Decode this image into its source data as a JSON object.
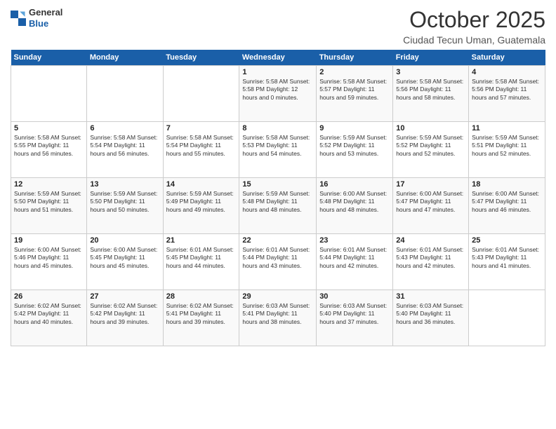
{
  "logo": {
    "general": "General",
    "blue": "Blue"
  },
  "header": {
    "title": "October 2025",
    "location": "Ciudad Tecun Uman, Guatemala"
  },
  "days": [
    "Sunday",
    "Monday",
    "Tuesday",
    "Wednesday",
    "Thursday",
    "Friday",
    "Saturday"
  ],
  "weeks": [
    [
      {
        "num": "",
        "detail": ""
      },
      {
        "num": "",
        "detail": ""
      },
      {
        "num": "",
        "detail": ""
      },
      {
        "num": "1",
        "detail": "Sunrise: 5:58 AM\nSunset: 5:58 PM\nDaylight: 12 hours\nand 0 minutes."
      },
      {
        "num": "2",
        "detail": "Sunrise: 5:58 AM\nSunset: 5:57 PM\nDaylight: 11 hours\nand 59 minutes."
      },
      {
        "num": "3",
        "detail": "Sunrise: 5:58 AM\nSunset: 5:56 PM\nDaylight: 11 hours\nand 58 minutes."
      },
      {
        "num": "4",
        "detail": "Sunrise: 5:58 AM\nSunset: 5:56 PM\nDaylight: 11 hours\nand 57 minutes."
      }
    ],
    [
      {
        "num": "5",
        "detail": "Sunrise: 5:58 AM\nSunset: 5:55 PM\nDaylight: 11 hours\nand 56 minutes."
      },
      {
        "num": "6",
        "detail": "Sunrise: 5:58 AM\nSunset: 5:54 PM\nDaylight: 11 hours\nand 56 minutes."
      },
      {
        "num": "7",
        "detail": "Sunrise: 5:58 AM\nSunset: 5:54 PM\nDaylight: 11 hours\nand 55 minutes."
      },
      {
        "num": "8",
        "detail": "Sunrise: 5:58 AM\nSunset: 5:53 PM\nDaylight: 11 hours\nand 54 minutes."
      },
      {
        "num": "9",
        "detail": "Sunrise: 5:59 AM\nSunset: 5:52 PM\nDaylight: 11 hours\nand 53 minutes."
      },
      {
        "num": "10",
        "detail": "Sunrise: 5:59 AM\nSunset: 5:52 PM\nDaylight: 11 hours\nand 52 minutes."
      },
      {
        "num": "11",
        "detail": "Sunrise: 5:59 AM\nSunset: 5:51 PM\nDaylight: 11 hours\nand 52 minutes."
      }
    ],
    [
      {
        "num": "12",
        "detail": "Sunrise: 5:59 AM\nSunset: 5:50 PM\nDaylight: 11 hours\nand 51 minutes."
      },
      {
        "num": "13",
        "detail": "Sunrise: 5:59 AM\nSunset: 5:50 PM\nDaylight: 11 hours\nand 50 minutes."
      },
      {
        "num": "14",
        "detail": "Sunrise: 5:59 AM\nSunset: 5:49 PM\nDaylight: 11 hours\nand 49 minutes."
      },
      {
        "num": "15",
        "detail": "Sunrise: 5:59 AM\nSunset: 5:48 PM\nDaylight: 11 hours\nand 48 minutes."
      },
      {
        "num": "16",
        "detail": "Sunrise: 6:00 AM\nSunset: 5:48 PM\nDaylight: 11 hours\nand 48 minutes."
      },
      {
        "num": "17",
        "detail": "Sunrise: 6:00 AM\nSunset: 5:47 PM\nDaylight: 11 hours\nand 47 minutes."
      },
      {
        "num": "18",
        "detail": "Sunrise: 6:00 AM\nSunset: 5:47 PM\nDaylight: 11 hours\nand 46 minutes."
      }
    ],
    [
      {
        "num": "19",
        "detail": "Sunrise: 6:00 AM\nSunset: 5:46 PM\nDaylight: 11 hours\nand 45 minutes."
      },
      {
        "num": "20",
        "detail": "Sunrise: 6:00 AM\nSunset: 5:45 PM\nDaylight: 11 hours\nand 45 minutes."
      },
      {
        "num": "21",
        "detail": "Sunrise: 6:01 AM\nSunset: 5:45 PM\nDaylight: 11 hours\nand 44 minutes."
      },
      {
        "num": "22",
        "detail": "Sunrise: 6:01 AM\nSunset: 5:44 PM\nDaylight: 11 hours\nand 43 minutes."
      },
      {
        "num": "23",
        "detail": "Sunrise: 6:01 AM\nSunset: 5:44 PM\nDaylight: 11 hours\nand 42 minutes."
      },
      {
        "num": "24",
        "detail": "Sunrise: 6:01 AM\nSunset: 5:43 PM\nDaylight: 11 hours\nand 42 minutes."
      },
      {
        "num": "25",
        "detail": "Sunrise: 6:01 AM\nSunset: 5:43 PM\nDaylight: 11 hours\nand 41 minutes."
      }
    ],
    [
      {
        "num": "26",
        "detail": "Sunrise: 6:02 AM\nSunset: 5:42 PM\nDaylight: 11 hours\nand 40 minutes."
      },
      {
        "num": "27",
        "detail": "Sunrise: 6:02 AM\nSunset: 5:42 PM\nDaylight: 11 hours\nand 39 minutes."
      },
      {
        "num": "28",
        "detail": "Sunrise: 6:02 AM\nSunset: 5:41 PM\nDaylight: 11 hours\nand 39 minutes."
      },
      {
        "num": "29",
        "detail": "Sunrise: 6:03 AM\nSunset: 5:41 PM\nDaylight: 11 hours\nand 38 minutes."
      },
      {
        "num": "30",
        "detail": "Sunrise: 6:03 AM\nSunset: 5:40 PM\nDaylight: 11 hours\nand 37 minutes."
      },
      {
        "num": "31",
        "detail": "Sunrise: 6:03 AM\nSunset: 5:40 PM\nDaylight: 11 hours\nand 36 minutes."
      },
      {
        "num": "",
        "detail": ""
      }
    ]
  ]
}
